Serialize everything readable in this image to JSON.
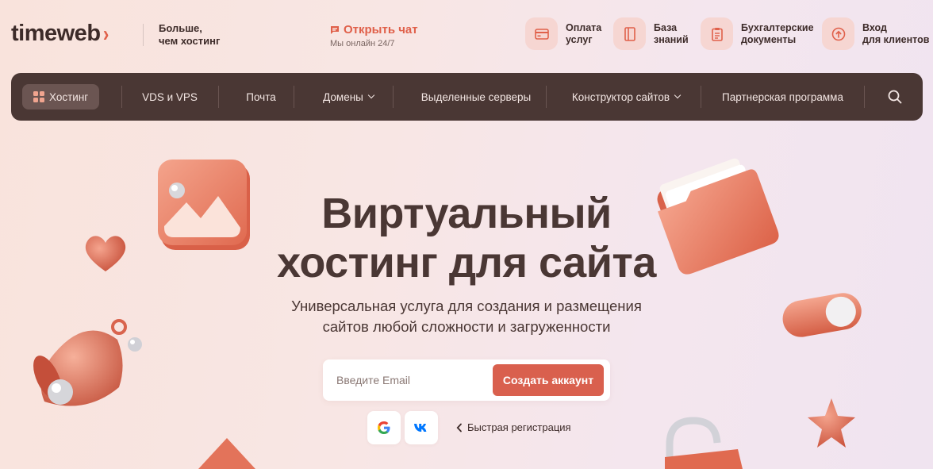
{
  "header": {
    "logo_text": "timeweb",
    "logo_chevron": "›",
    "tagline_line1": "Больше,",
    "tagline_line2": "чем хостинг",
    "chat": {
      "label": "Открыть чат",
      "status": "Мы онлайн 24/7",
      "icon": "chat-icon"
    },
    "quick_links": [
      {
        "line1": "Оплата",
        "line2": "услуг",
        "icon": "card-icon"
      },
      {
        "line1": "База",
        "line2": "знаний",
        "icon": "book-icon"
      },
      {
        "line1": "Бухгалтерские",
        "line2": "документы",
        "icon": "document-icon"
      },
      {
        "line1": "Вход",
        "line2": "для клиентов",
        "icon": "login-icon"
      }
    ]
  },
  "nav": {
    "items": [
      {
        "label": "Хостинг",
        "active": true,
        "icon": "grid-icon"
      },
      {
        "label": "VDS и VPS"
      },
      {
        "label": "Почта"
      },
      {
        "label": "Домены",
        "dropdown": true
      },
      {
        "label": "Выделенные серверы"
      },
      {
        "label": "Конструктор сайтов",
        "dropdown": true
      },
      {
        "label": "Партнерская программа"
      }
    ],
    "search_icon": "search-icon"
  },
  "hero": {
    "title_line1": "Виртуальный",
    "title_line2": "хостинг для сайта",
    "subtitle_line1": "Универсальная услуга для создания и размещения",
    "subtitle_line2": "сайтов любой сложности и загруженности"
  },
  "signup": {
    "email_placeholder": "Введите Email",
    "email_value": "",
    "button_label": "Создать аккаунт",
    "social": [
      {
        "name": "Google",
        "icon": "google-icon"
      },
      {
        "name": "VK",
        "icon": "vk-icon"
      }
    ],
    "quick_reg_label": "Быстрая регистрация"
  },
  "colors": {
    "accent": "#d9604e",
    "brand_dark": "#4a3734",
    "icon_tile": "#f6d6d2",
    "background": "#f8e6e4"
  }
}
